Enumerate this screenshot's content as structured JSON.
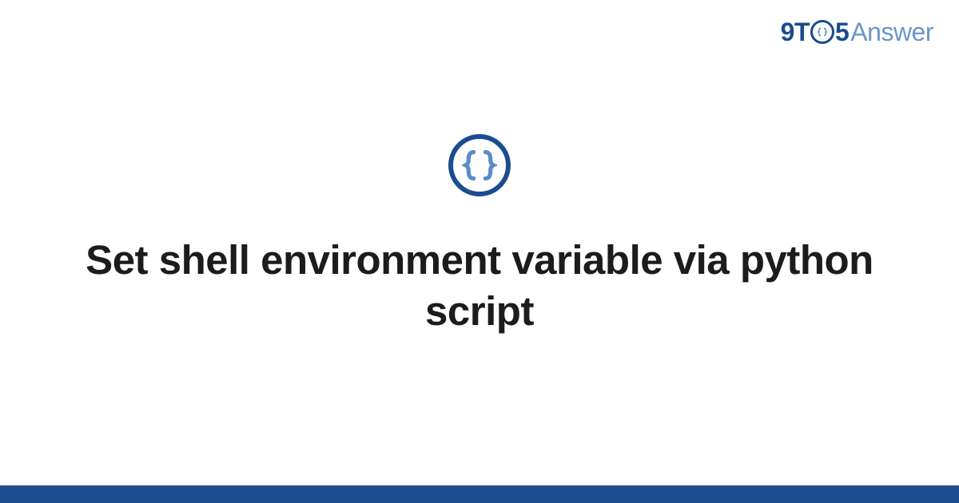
{
  "brand": {
    "part1": "9T",
    "part2": "5",
    "part3": "Answer"
  },
  "title": "Set shell environment variable via python script",
  "colors": {
    "primary": "#1a4c8f",
    "secondary": "#6b96c9",
    "text": "#1c1c1c"
  }
}
